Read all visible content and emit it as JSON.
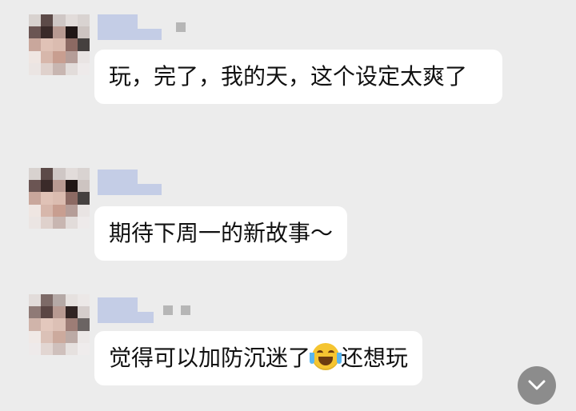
{
  "colors": {
    "background": "#ececec",
    "bubble": "#ffffff",
    "text": "#111111",
    "scroll_button": "#8c8c8c"
  },
  "messages": [
    {
      "text": "玩，完了，我的天，这个设定太爽了"
    },
    {
      "text": "期待下周一的新故事～"
    },
    {
      "text_before": "觉得可以加防沉迷了",
      "emoji": "face-with-tears-of-joy-icon",
      "text_after": "还想玩"
    }
  ],
  "scroll_button": {
    "icon": "chevron-down-icon"
  }
}
